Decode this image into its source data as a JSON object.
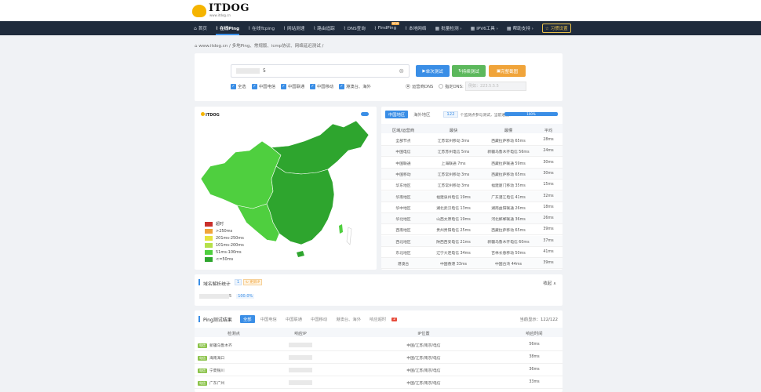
{
  "logo": {
    "title": "ITDOG",
    "sub": "www.itdog.cn"
  },
  "nav": [
    {
      "icon": "home",
      "label": "首页"
    },
    {
      "icon": "pulse",
      "label": "在线Ping",
      "active": true
    },
    {
      "icon": "pulse",
      "label": "在线Tcping"
    },
    {
      "icon": "pulse",
      "label": "网站测速"
    },
    {
      "icon": "pulse",
      "label": "路由追踪"
    },
    {
      "icon": "pulse",
      "label": "DNS查询"
    },
    {
      "icon": "pulse",
      "label": "FindPing",
      "badge": "NEW"
    },
    {
      "icon": "pulse",
      "label": "本地网络"
    },
    {
      "icon": "grid",
      "label": "批量检测 ›"
    },
    {
      "icon": "grid",
      "label": "IPV6工具 ›"
    },
    {
      "icon": "grid",
      "label": "帮助支持 ›"
    }
  ],
  "nav_btn": "☆ 习惯设置",
  "crumb": "⌂ www.itdog.cn  /  多地Ping、常规版、icmp协议、网络延迟测试  /",
  "search": {
    "value": "5"
  },
  "buttons": {
    "single": "单次测试",
    "continuous": "持续测试",
    "screenshot": "完整截图"
  },
  "checks": [
    "全选",
    "中国电信",
    "中国联通",
    "中国移动",
    "港澳台、海外"
  ],
  "dns": {
    "opt1": "运营商DNS",
    "opt2": "指定DNS:",
    "placeholder": "例如：223.5.5.5"
  },
  "map": {
    "logo": "ITDOG"
  },
  "legend": [
    {
      "label": "超时",
      "color": "#c9302c"
    },
    {
      "label": ">250ms",
      "color": "#f0a43a"
    },
    {
      "label": "201ms-250ms",
      "color": "#e6e33c"
    },
    {
      "label": "101ms-200ms",
      "color": "#b5e04a"
    },
    {
      "label": "51ms-100ms",
      "color": "#4fcf3f"
    },
    {
      "label": "<=50ms",
      "color": "#2ea52e"
    }
  ],
  "table": {
    "tabs": [
      "中国地区",
      "海外地区"
    ],
    "count": "122",
    "count_text": "个监测点参与测试，当前进度：",
    "progress": "100%",
    "headers": [
      "区域/运营商",
      "最快",
      "最慢",
      "平均"
    ],
    "rows": [
      [
        "全部节点",
        "江苏常州移动 3ms",
        "西藏拉萨移动 65ms",
        "28ms"
      ],
      [
        "中国电信",
        "江苏苏州电信 5ms",
        "新疆乌鲁木齐电信 56ms",
        "24ms"
      ],
      [
        "中国联通",
        "上海联通 7ms",
        "西藏拉萨联通 59ms",
        "30ms"
      ],
      [
        "中国移动",
        "江苏常州移动 3ms",
        "西藏拉萨移动 65ms",
        "30ms"
      ],
      [
        "华东地区",
        "江苏常州移动 3ms",
        "福建厦门移动 35ms",
        "15ms"
      ],
      [
        "华南地区",
        "福建泉州电信 19ms",
        "广东湛江电信 41ms",
        "32ms"
      ],
      [
        "华中地区",
        "湖北武汉电信 13ms",
        "湖南益阳联通 26ms",
        "18ms"
      ],
      [
        "华北地区",
        "山西太原电信 19ms",
        "河北邯郸联通 36ms",
        "26ms"
      ],
      [
        "西南地区",
        "贵州贵阳电信 25ms",
        "西藏拉萨移动 65ms",
        "39ms"
      ],
      [
        "西北地区",
        "陕西西安电信 21ms",
        "新疆乌鲁木齐电信 60ms",
        "37ms"
      ],
      [
        "东北地区",
        "辽宁大连电信 34ms",
        "吉林长春移动 50ms",
        "41ms"
      ],
      [
        "港澳台",
        "中国香港 33ms",
        "中国台湾 44ms",
        "39ms"
      ]
    ]
  },
  "resolve": {
    "title": "域名解析统计",
    "count": "1",
    "btn": "↻ 更新IP",
    "collapse": "收起 ∧",
    "ip_suffix": "5",
    "pct": "100.0%"
  },
  "ping": {
    "title": "Ping测试结果",
    "tabs": [
      "全部",
      "中国电信",
      "中国联通",
      "中国移动",
      "港澳台、海外",
      "响应超时"
    ],
    "timeout": "2",
    "display": "当前显示：122/122",
    "headers": [
      "检测点",
      "响应IP",
      "IP位置",
      "响应时间"
    ],
    "rows": [
      [
        "电信",
        "新疆乌鲁木齐",
        "中国/江苏/南京/电信",
        "56ms"
      ],
      [
        "电信",
        "海南海口",
        "中国/江苏/南京/电信",
        "38ms"
      ],
      [
        "电信",
        "宁夏银川",
        "中国/江苏/南京/电信",
        "36ms"
      ],
      [
        "电信",
        "广东广州",
        "中国/江苏/南京/电信",
        "33ms"
      ]
    ]
  }
}
